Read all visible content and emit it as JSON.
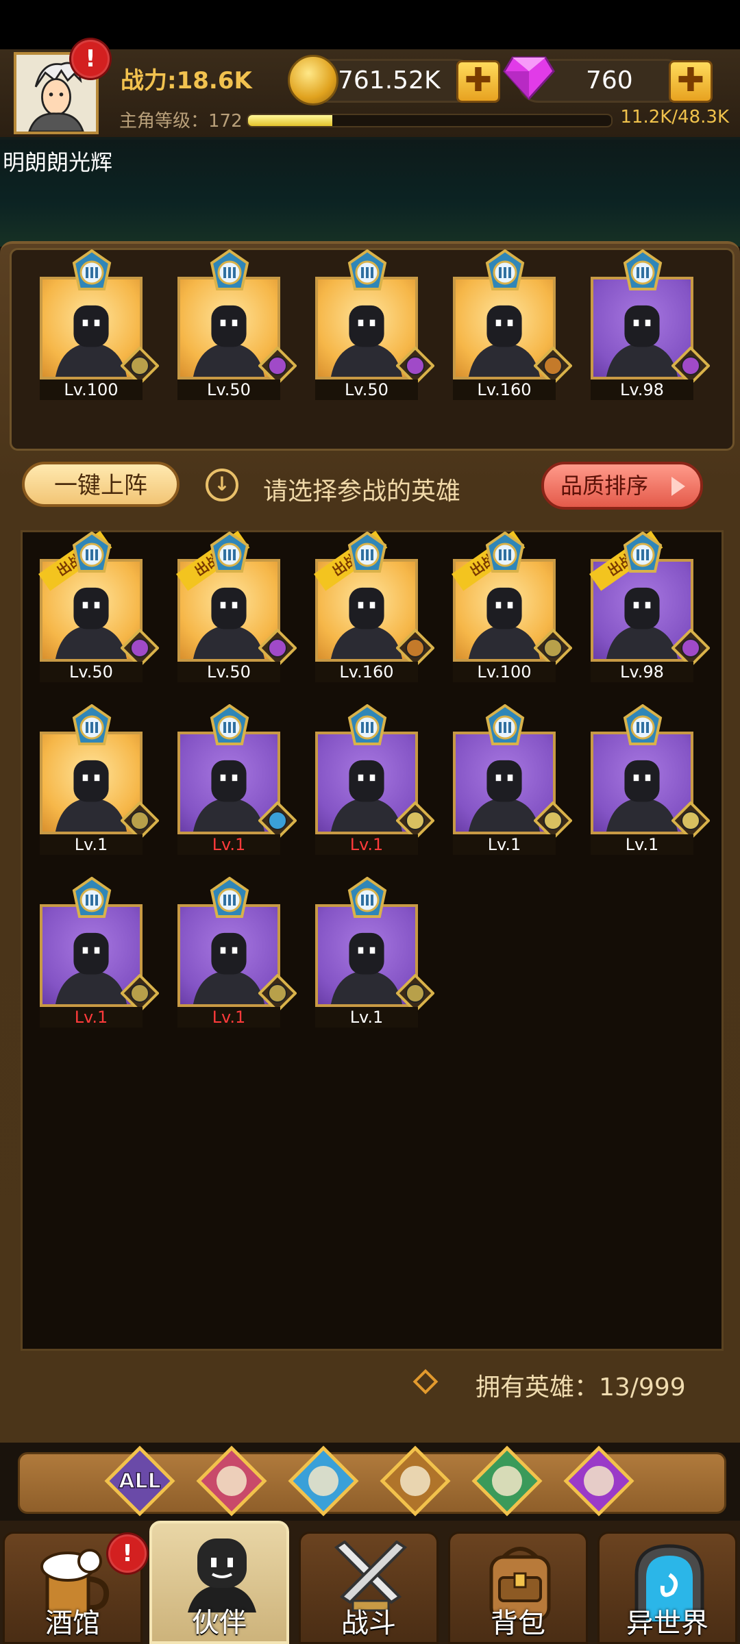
{
  "header": {
    "power_label": "战力:18.6K",
    "level_label": "主角等级：172",
    "xp_text": "11.2K/48.3K",
    "xp_progress": 0.232,
    "gold": "761.52K",
    "gems": "760",
    "username": "明朗朗光辉",
    "plus": "✚",
    "alert": "!"
  },
  "formation": [
    {
      "level": "Lv.100",
      "bg": "gold",
      "race": "crown-icon"
    },
    {
      "level": "Lv.50",
      "bg": "gold",
      "race": "demon-icon"
    },
    {
      "level": "Lv.50",
      "bg": "gold",
      "race": "demon-icon"
    },
    {
      "level": "Lv.160",
      "bg": "gold",
      "race": "beast-icon"
    },
    {
      "level": "Lv.98",
      "bg": "purple",
      "race": "demon-icon"
    }
  ],
  "actions": {
    "one_click_label": "一键上阵",
    "hint": "请选择参战的英雄",
    "hint_icon": "↓",
    "sort_label": "品质排序"
  },
  "roster": [
    {
      "level": "Lv.50",
      "bg": "gold",
      "in_battle": true,
      "low": false
    },
    {
      "level": "Lv.50",
      "bg": "gold",
      "in_battle": true,
      "low": false
    },
    {
      "level": "Lv.160",
      "bg": "gold",
      "in_battle": true,
      "low": false
    },
    {
      "level": "Lv.100",
      "bg": "gold",
      "in_battle": true,
      "low": false
    },
    {
      "level": "Lv.98",
      "bg": "purple",
      "in_battle": true,
      "low": false
    },
    {
      "level": "Lv.1",
      "bg": "gold",
      "in_battle": false,
      "low": false
    },
    {
      "level": "Lv.1",
      "bg": "purple",
      "in_battle": false,
      "low": true
    },
    {
      "level": "Lv.1",
      "bg": "purple",
      "in_battle": false,
      "low": true
    },
    {
      "level": "Lv.1",
      "bg": "purple",
      "in_battle": false,
      "low": false
    },
    {
      "level": "Lv.1",
      "bg": "purple",
      "in_battle": false,
      "low": false
    },
    {
      "level": "Lv.1",
      "bg": "purple",
      "in_battle": false,
      "low": true
    },
    {
      "level": "Lv.1",
      "bg": "purple",
      "in_battle": false,
      "low": true
    },
    {
      "level": "Lv.1",
      "bg": "purple",
      "in_battle": false,
      "low": false
    }
  ],
  "in_battle_tag": "出战中",
  "owned_text": "拥有英雄：13/999",
  "filters": {
    "all": "ALL"
  },
  "nav": {
    "tavern": "酒馆",
    "partner": "伙伴",
    "battle": "战斗",
    "bag": "背包",
    "otherworld": "异世界"
  }
}
